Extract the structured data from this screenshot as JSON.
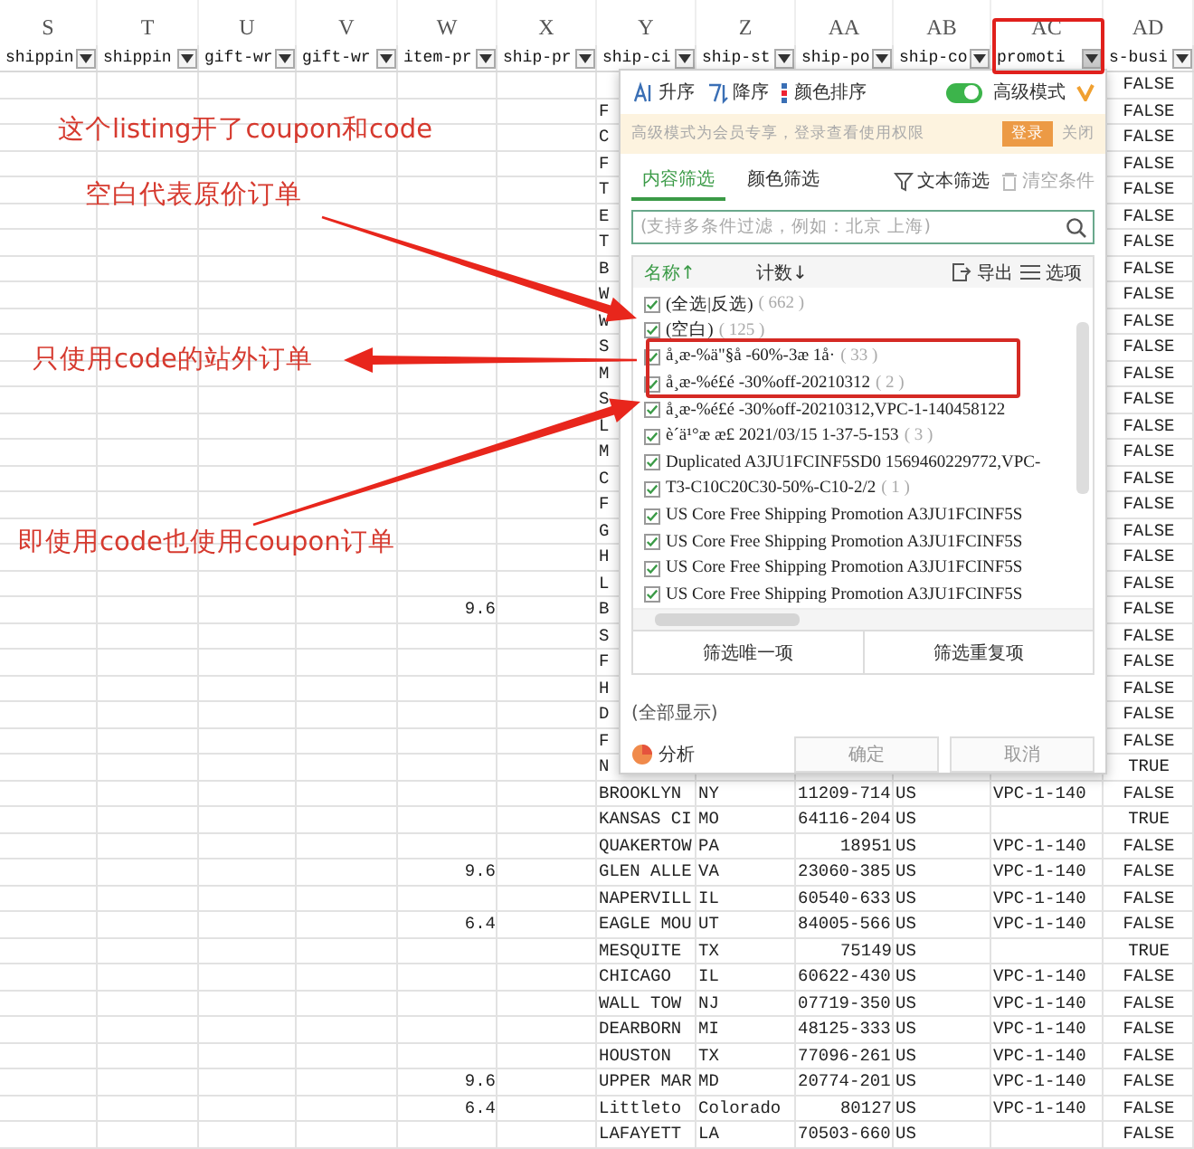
{
  "columns": [
    {
      "letter": "S",
      "field": "shippin",
      "highlighted": false
    },
    {
      "letter": "T",
      "field": "shippin",
      "highlighted": false
    },
    {
      "letter": "U",
      "field": "gift-wr",
      "highlighted": false
    },
    {
      "letter": "V",
      "field": "gift-wr",
      "highlighted": false
    },
    {
      "letter": "W",
      "field": "item-pr",
      "highlighted": false
    },
    {
      "letter": "X",
      "field": "ship-pr",
      "highlighted": false
    },
    {
      "letter": "Y",
      "field": "ship-ci",
      "highlighted": false
    },
    {
      "letter": "Z",
      "field": "ship-st",
      "highlighted": false
    },
    {
      "letter": "AA",
      "field": "ship-po",
      "highlighted": false
    },
    {
      "letter": "AB",
      "field": "ship-co",
      "highlighted": false
    },
    {
      "letter": "AC",
      "field": "promoti",
      "highlighted": true
    },
    {
      "letter": "AD",
      "field": "s-busi",
      "highlighted": false
    }
  ],
  "rows": [
    {
      "is_business": {
        "text": "FALSE",
        "kind": "bool"
      }
    },
    {
      "ship_city": {
        "text": "F",
        "kind": "text"
      },
      "is_business": {
        "text": "FALSE",
        "kind": "bool"
      }
    },
    {
      "ship_city": {
        "text": "C",
        "kind": "text"
      },
      "is_business": {
        "text": "FALSE",
        "kind": "bool"
      }
    },
    {
      "ship_city": {
        "text": "F",
        "kind": "text"
      },
      "is_business": {
        "text": "FALSE",
        "kind": "bool"
      }
    },
    {
      "ship_city": {
        "text": "T",
        "kind": "text"
      },
      "is_business": {
        "text": "FALSE",
        "kind": "bool"
      }
    },
    {
      "ship_city": {
        "text": "E",
        "kind": "text"
      },
      "is_business": {
        "text": "FALSE",
        "kind": "bool"
      }
    },
    {
      "ship_city": {
        "text": "T",
        "kind": "text"
      },
      "is_business": {
        "text": "FALSE",
        "kind": "bool"
      }
    },
    {
      "ship_city": {
        "text": "B",
        "kind": "text"
      },
      "is_business": {
        "text": "FALSE",
        "kind": "bool"
      }
    },
    {
      "ship_city": {
        "text": "W",
        "kind": "text"
      },
      "is_business": {
        "text": "FALSE",
        "kind": "bool"
      }
    },
    {
      "ship_city": {
        "text": "W",
        "kind": "text"
      },
      "is_business": {
        "text": "FALSE",
        "kind": "bool"
      }
    },
    {
      "ship_city": {
        "text": "S",
        "kind": "text"
      },
      "is_business": {
        "text": "FALSE",
        "kind": "bool"
      }
    },
    {
      "ship_city": {
        "text": "M",
        "kind": "text"
      },
      "is_business": {
        "text": "FALSE",
        "kind": "bool"
      }
    },
    {
      "ship_city": {
        "text": "S",
        "kind": "text"
      },
      "is_business": {
        "text": "FALSE",
        "kind": "bool"
      }
    },
    {
      "ship_city": {
        "text": "L",
        "kind": "text"
      },
      "is_business": {
        "text": "FALSE",
        "kind": "bool"
      }
    },
    {
      "ship_city": {
        "text": "M",
        "kind": "text"
      },
      "is_business": {
        "text": "FALSE",
        "kind": "bool"
      }
    },
    {
      "ship_city": {
        "text": "C",
        "kind": "text"
      },
      "is_business": {
        "text": "FALSE",
        "kind": "bool"
      }
    },
    {
      "ship_city": {
        "text": "F",
        "kind": "text"
      },
      "is_business": {
        "text": "FALSE",
        "kind": "bool"
      }
    },
    {
      "ship_city": {
        "text": "G",
        "kind": "text"
      },
      "is_business": {
        "text": "FALSE",
        "kind": "bool"
      }
    },
    {
      "ship_city": {
        "text": "H",
        "kind": "text"
      },
      "is_business": {
        "text": "FALSE",
        "kind": "bool"
      }
    },
    {
      "ship_city": {
        "text": "L",
        "kind": "text"
      },
      "is_business": {
        "text": "FALSE",
        "kind": "bool"
      }
    },
    {
      "item_pr": {
        "text": "9.6",
        "kind": "number"
      },
      "ship_city": {
        "text": "B",
        "kind": "text"
      },
      "is_business": {
        "text": "FALSE",
        "kind": "bool"
      }
    },
    {
      "ship_city": {
        "text": "S",
        "kind": "text"
      },
      "is_business": {
        "text": "FALSE",
        "kind": "bool"
      }
    },
    {
      "ship_city": {
        "text": "F",
        "kind": "text"
      },
      "is_business": {
        "text": "FALSE",
        "kind": "bool"
      }
    },
    {
      "ship_city": {
        "text": "H",
        "kind": "text"
      },
      "is_business": {
        "text": "FALSE",
        "kind": "bool"
      }
    },
    {
      "ship_city": {
        "text": "D",
        "kind": "text"
      },
      "is_business": {
        "text": "FALSE",
        "kind": "bool"
      }
    },
    {
      "ship_city": {
        "text": "F",
        "kind": "text"
      },
      "is_business": {
        "text": "FALSE",
        "kind": "bool"
      }
    },
    {
      "ship_city": {
        "text": "N",
        "kind": "text"
      },
      "is_business": {
        "text": "TRUE",
        "kind": "bool"
      }
    },
    {
      "ship_city": {
        "text": "BROOKLYN",
        "kind": "text"
      },
      "ship_state": {
        "text": "NY",
        "kind": "text"
      },
      "ship_postal": {
        "text": "11209-714",
        "kind": "text"
      },
      "ship_country": {
        "text": "US",
        "kind": "text"
      },
      "promotion": {
        "text": "VPC-1-140",
        "kind": "text"
      },
      "is_business": {
        "text": "FALSE",
        "kind": "bool"
      }
    },
    {
      "ship_city": {
        "text": "KANSAS CI",
        "kind": "text"
      },
      "ship_state": {
        "text": "MO",
        "kind": "text"
      },
      "ship_postal": {
        "text": "64116-204",
        "kind": "text"
      },
      "ship_country": {
        "text": "US",
        "kind": "text"
      },
      "is_business": {
        "text": "TRUE",
        "kind": "bool"
      }
    },
    {
      "ship_city": {
        "text": "QUAKERTOW",
        "kind": "text"
      },
      "ship_state": {
        "text": "PA",
        "kind": "text"
      },
      "ship_postal": {
        "text": "18951",
        "kind": "number"
      },
      "ship_country": {
        "text": "US",
        "kind": "text"
      },
      "promotion": {
        "text": "VPC-1-140",
        "kind": "text"
      },
      "is_business": {
        "text": "FALSE",
        "kind": "bool"
      }
    },
    {
      "item_pr": {
        "text": "9.6",
        "kind": "number"
      },
      "ship_city": {
        "text": "GLEN ALLE",
        "kind": "text"
      },
      "ship_state": {
        "text": "VA",
        "kind": "text"
      },
      "ship_postal": {
        "text": "23060-385",
        "kind": "text"
      },
      "ship_country": {
        "text": "US",
        "kind": "text"
      },
      "promotion": {
        "text": "VPC-1-140",
        "kind": "text"
      },
      "is_business": {
        "text": "FALSE",
        "kind": "bool"
      }
    },
    {
      "ship_city": {
        "text": "NAPERVILL",
        "kind": "text"
      },
      "ship_state": {
        "text": "IL",
        "kind": "text"
      },
      "ship_postal": {
        "text": "60540-633",
        "kind": "text"
      },
      "ship_country": {
        "text": "US",
        "kind": "text"
      },
      "promotion": {
        "text": "VPC-1-140",
        "kind": "text"
      },
      "is_business": {
        "text": "FALSE",
        "kind": "bool"
      }
    },
    {
      "item_pr": {
        "text": "6.4",
        "kind": "number"
      },
      "ship_city": {
        "text": "EAGLE MOU",
        "kind": "text"
      },
      "ship_state": {
        "text": "UT",
        "kind": "text"
      },
      "ship_postal": {
        "text": "84005-566",
        "kind": "text"
      },
      "ship_country": {
        "text": "US",
        "kind": "text"
      },
      "promotion": {
        "text": "VPC-1-140",
        "kind": "text"
      },
      "is_business": {
        "text": "FALSE",
        "kind": "bool"
      }
    },
    {
      "ship_city": {
        "text": "MESQUITE",
        "kind": "text"
      },
      "ship_state": {
        "text": "TX",
        "kind": "text"
      },
      "ship_postal": {
        "text": "75149",
        "kind": "number"
      },
      "ship_country": {
        "text": "US",
        "kind": "text"
      },
      "is_business": {
        "text": "TRUE",
        "kind": "bool"
      }
    },
    {
      "ship_city": {
        "text": "CHICAGO",
        "kind": "text"
      },
      "ship_state": {
        "text": "IL",
        "kind": "text"
      },
      "ship_postal": {
        "text": "60622-430",
        "kind": "text"
      },
      "ship_country": {
        "text": "US",
        "kind": "text"
      },
      "promotion": {
        "text": "VPC-1-140",
        "kind": "text"
      },
      "is_business": {
        "text": "FALSE",
        "kind": "bool"
      }
    },
    {
      "ship_city": {
        "text": "WALL TOW",
        "kind": "text"
      },
      "ship_state": {
        "text": "NJ",
        "kind": "text"
      },
      "ship_postal": {
        "text": "07719-350",
        "kind": "text"
      },
      "ship_country": {
        "text": "US",
        "kind": "text"
      },
      "promotion": {
        "text": "VPC-1-140",
        "kind": "text"
      },
      "is_business": {
        "text": "FALSE",
        "kind": "bool"
      }
    },
    {
      "ship_city": {
        "text": "DEARBORN",
        "kind": "text"
      },
      "ship_state": {
        "text": "MI",
        "kind": "text"
      },
      "ship_postal": {
        "text": "48125-333",
        "kind": "text"
      },
      "ship_country": {
        "text": "US",
        "kind": "text"
      },
      "promotion": {
        "text": "VPC-1-140",
        "kind": "text"
      },
      "is_business": {
        "text": "FALSE",
        "kind": "bool"
      }
    },
    {
      "ship_city": {
        "text": "HOUSTON",
        "kind": "text"
      },
      "ship_state": {
        "text": "TX",
        "kind": "text"
      },
      "ship_postal": {
        "text": "77096-261",
        "kind": "text"
      },
      "ship_country": {
        "text": "US",
        "kind": "text"
      },
      "promotion": {
        "text": "VPC-1-140",
        "kind": "text"
      },
      "is_business": {
        "text": "FALSE",
        "kind": "bool"
      }
    },
    {
      "item_pr": {
        "text": "9.6",
        "kind": "number"
      },
      "ship_city": {
        "text": "UPPER MAR",
        "kind": "text"
      },
      "ship_state": {
        "text": "MD",
        "kind": "text"
      },
      "ship_postal": {
        "text": "20774-201",
        "kind": "text"
      },
      "ship_country": {
        "text": "US",
        "kind": "text"
      },
      "promotion": {
        "text": "VPC-1-140",
        "kind": "text"
      },
      "is_business": {
        "text": "FALSE",
        "kind": "bool"
      }
    },
    {
      "item_pr": {
        "text": "6.4",
        "kind": "number"
      },
      "ship_city": {
        "text": "Littleto",
        "kind": "text"
      },
      "ship_state": {
        "text": "Colorado",
        "kind": "text"
      },
      "ship_postal": {
        "text": "80127",
        "kind": "number"
      },
      "ship_country": {
        "text": "US",
        "kind": "text"
      },
      "promotion": {
        "text": "VPC-1-140",
        "kind": "text"
      },
      "is_business": {
        "text": "FALSE",
        "kind": "bool"
      }
    },
    {
      "ship_city": {
        "text": "LAFAYETT",
        "kind": "text"
      },
      "ship_state": {
        "text": "LA",
        "kind": "text"
      },
      "ship_postal": {
        "text": "70503-660",
        "kind": "text"
      },
      "ship_country": {
        "text": "US",
        "kind": "text"
      },
      "is_business": {
        "text": "FALSE",
        "kind": "bool"
      }
    }
  ],
  "filter_popup": {
    "sort_buttons": [
      {
        "label": "升序",
        "kind": "asc"
      },
      {
        "label": "降序",
        "kind": "desc"
      },
      {
        "label": "颜色排序",
        "kind": "color"
      }
    ],
    "advanced_mode": {
      "label": "高级模式",
      "on": true
    },
    "banner": {
      "text": "高级模式为会员专享，登录查看使用权限",
      "login": "登录",
      "close": "关闭"
    },
    "tabs": [
      {
        "label": "内容筛选",
        "selected": true
      },
      {
        "label": "颜色筛选",
        "selected": false
      }
    ],
    "text_filter": "文本筛选",
    "clear": {
      "label": "清空条件",
      "disabled": true
    },
    "search": {
      "placeholder": "(支持多条件过滤，例如：北京 上海)"
    },
    "list_header": {
      "name": "名称↑",
      "count": "计数↓",
      "export": "导出",
      "options": "选项"
    },
    "items": [
      {
        "label": "(全选|反选)",
        "count": "( 662 )",
        "checked": true
      },
      {
        "label": "(空白)",
        "count": "( 125 )",
        "checked": true
      },
      {
        "label": "å¸æ-%ä\"§å -60%-3æ 1å·",
        "count": "( 33 )",
        "checked": true
      },
      {
        "label": "å¸æ-%é£é -30%off-20210312",
        "count": "( 2 )",
        "checked": true
      },
      {
        "label": "å¸æ-%é£é -30%off-20210312,VPC-1-140458122",
        "checked": true
      },
      {
        "label": "è´ä¹°æ æ£ 2021/03/15 1-37-5-153",
        "count": "( 3 )",
        "checked": true
      },
      {
        "label": "Duplicated A3JU1FCINF5SD0 1569460229772,VPC-",
        "checked": true
      },
      {
        "label": "T3-C10C20C30-50%-C10-2/2",
        "count": "( 1 )",
        "checked": true
      },
      {
        "label": "US Core Free Shipping Promotion A3JU1FCINF5S",
        "checked": true
      },
      {
        "label": "US Core Free Shipping Promotion A3JU1FCINF5S",
        "checked": true
      },
      {
        "label": "US Core Free Shipping Promotion A3JU1FCINF5S",
        "checked": true
      },
      {
        "label": "US Core Free Shipping Promotion A3JU1FCINF5S",
        "checked": true
      }
    ],
    "unique_button": "筛选唯一项",
    "duplicate_button": "筛选重复项",
    "show_all": "(全部显示)",
    "analyze": "分析",
    "ok": "确定",
    "cancel": "取消"
  },
  "annotations": [
    {
      "text": "这个listing开了coupon和code"
    },
    {
      "text": "空白代表原价订单"
    },
    {
      "text": "只使用code的站外订单"
    },
    {
      "text": "即使用code也使用coupon订单"
    }
  ]
}
